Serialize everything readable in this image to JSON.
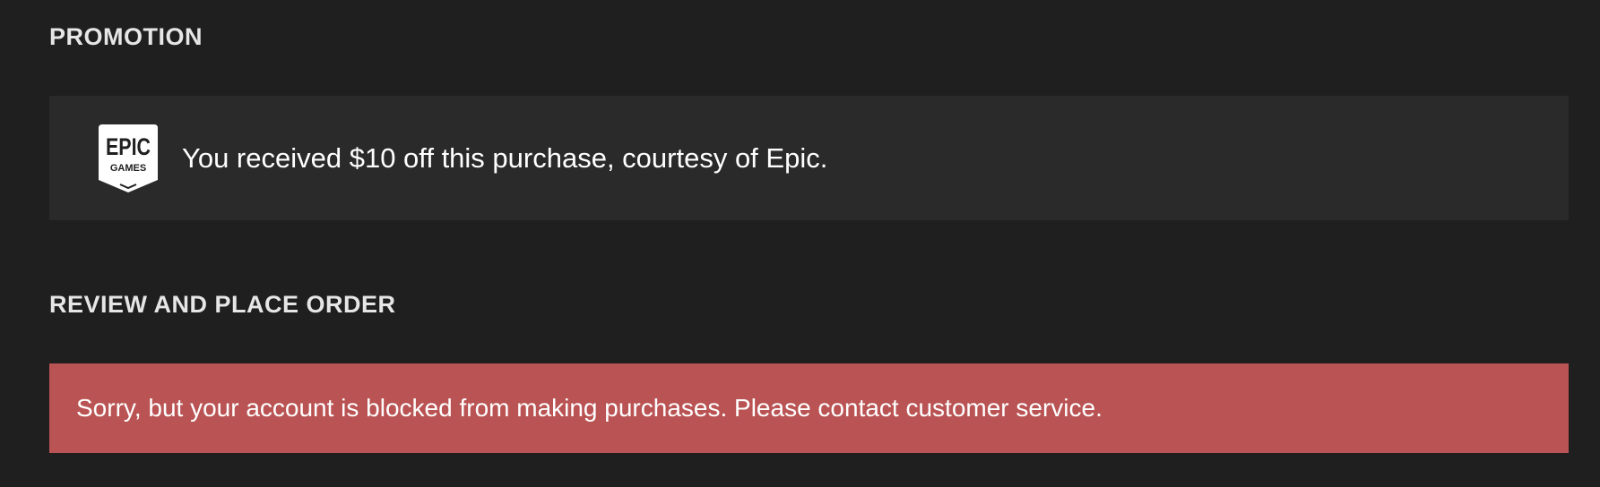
{
  "promotion": {
    "heading": "PROMOTION",
    "logo": {
      "icon": "epic-games-logo",
      "line1": "EPIC",
      "line2": "GAMES"
    },
    "message": "You received $10 off this purchase, courtesy of Epic."
  },
  "review": {
    "heading": "REVIEW AND PLACE ORDER",
    "error_message": "Sorry, but your account is blocked from making purchases. Please contact customer service."
  },
  "colors": {
    "background": "#1f1f1f",
    "promo_box": "#2a2a2a",
    "error_box": "#ba5353",
    "heading_text": "#e6e6e6",
    "text": "#ffffff"
  }
}
